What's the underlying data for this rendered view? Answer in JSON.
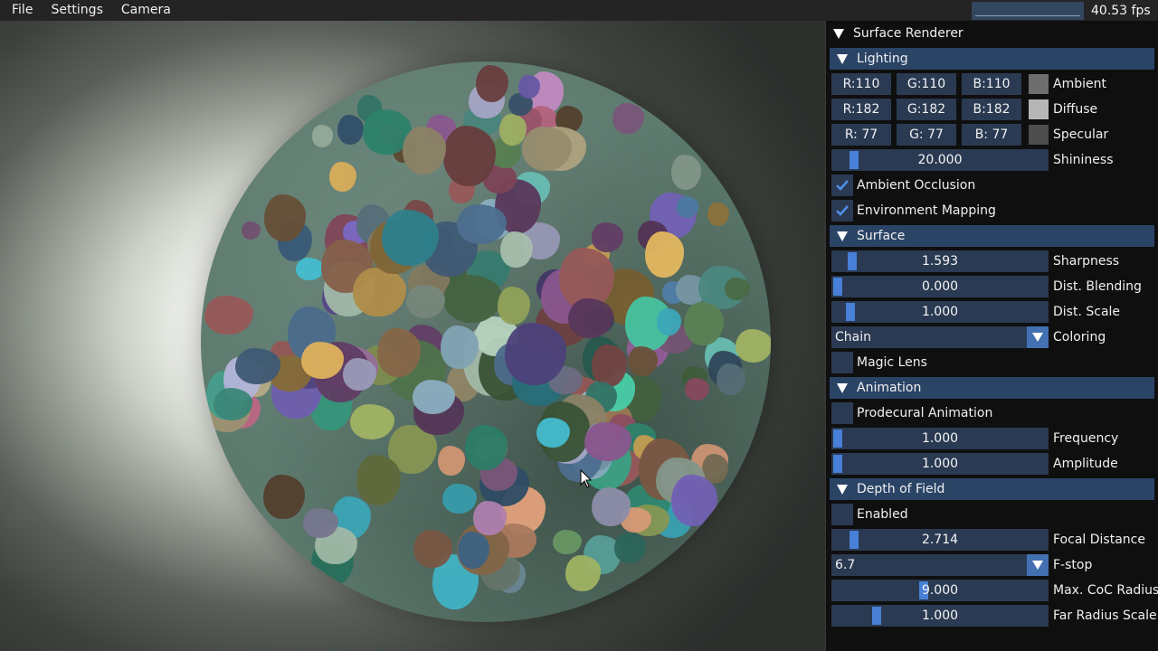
{
  "menu": {
    "items": [
      "File",
      "Settings",
      "Camera"
    ]
  },
  "status": {
    "fps": "40.53 fps"
  },
  "panel": {
    "title": "Surface Renderer",
    "lighting": {
      "header": "Lighting",
      "ambient": {
        "r": "R:110",
        "g": "G:110",
        "b": "B:110",
        "color": "#6e6e6e",
        "label": "Ambient"
      },
      "diffuse": {
        "r": "R:182",
        "g": "G:182",
        "b": "B:182",
        "color": "#b6b6b6",
        "label": "Diffuse"
      },
      "specular": {
        "r": "R: 77",
        "g": "G: 77",
        "b": "B: 77",
        "color": "#4d4d4d",
        "label": "Specular"
      },
      "shininess": {
        "value": "20.000",
        "label": "Shininess",
        "level": 0.08
      },
      "ambient_occlusion": {
        "label": "Ambient Occlusion",
        "checked": true
      },
      "environment_mapping": {
        "label": "Environment Mapping",
        "checked": true
      }
    },
    "surface": {
      "header": "Surface",
      "sharpness": {
        "value": "1.593",
        "label": "Sharpness",
        "level": 0.07
      },
      "dist_blending": {
        "value": "0.000",
        "label": "Dist. Blending",
        "level": 0.0
      },
      "dist_scale": {
        "value": "1.000",
        "label": "Dist. Scale",
        "level": 0.06
      },
      "coloring": {
        "value": "Chain",
        "label": "Coloring"
      },
      "magic_lens": {
        "label": "Magic Lens",
        "checked": false
      }
    },
    "animation": {
      "header": "Animation",
      "procedural": {
        "label": "Prodecural Animation",
        "checked": false
      },
      "frequency": {
        "value": "1.000",
        "label": "Frequency",
        "level": 0.0
      },
      "amplitude": {
        "value": "1.000",
        "label": "Amplitude",
        "level": 0.0
      }
    },
    "dof": {
      "header": "Depth of Field",
      "enabled": {
        "label": "Enabled",
        "checked": false
      },
      "focal_distance": {
        "value": "2.714",
        "label": "Focal Distance",
        "level": 0.08
      },
      "fstop": {
        "value": "6.7",
        "label": "F-stop"
      },
      "max_coc": {
        "value": "9.000",
        "label": "Max. CoC Radius",
        "level": 0.42
      },
      "far_radius_scale": {
        "value": "1.000",
        "label": "Far Radius Scale",
        "level": 0.19
      }
    }
  },
  "colors": {
    "accent": "#4780d6",
    "header_bg": "#2a4466",
    "frame_bg": "#2a3a52"
  }
}
